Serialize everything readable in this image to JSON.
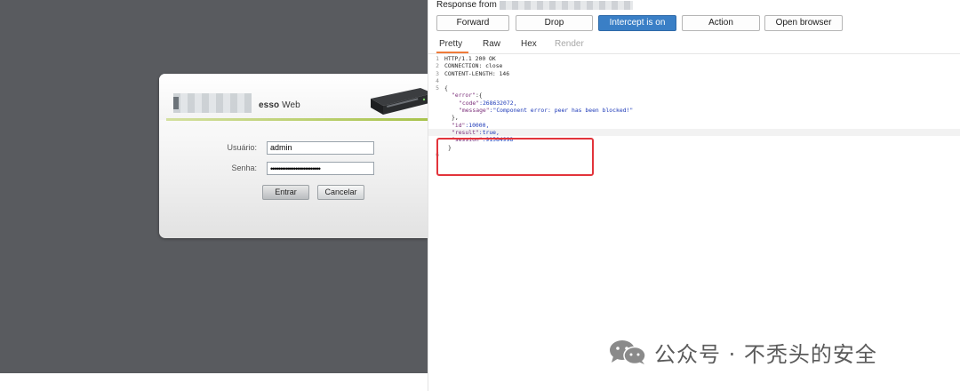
{
  "login": {
    "title_bold": "esso",
    "title_rest": " Web",
    "username_label": "Usuário:",
    "username_value": "admin",
    "password_label": "Senha:",
    "password_value": "••••••••••••••••••••••••••",
    "enter_button": "Entrar",
    "cancel_button": "Cancelar"
  },
  "burp": {
    "title": "Response from",
    "toolbar": {
      "forward": "Forward",
      "drop": "Drop",
      "intercept": "Intercept is on",
      "action": "Action",
      "open_browser": "Open browser"
    },
    "tabs": {
      "pretty": "Pretty",
      "raw": "Raw",
      "hex": "Hex",
      "render": "Render"
    },
    "lines": {
      "n1": "1",
      "t1": "HTTP/1.1 200 OK",
      "n2": "2",
      "t2": "CONNECTION: close",
      "n3": "3",
      "t3": "CONTENT-LENGTH: 146",
      "n4": "4",
      "n5": "5",
      "t5": "{",
      "t6_key": "\"error\"",
      "t6_rest": ":{",
      "t7_key": "\"code\"",
      "t7_val": ":268632072,",
      "t8_key": "\"message\"",
      "t8_val": ":\"Component error: peer has been blocked!\"",
      "t9": "},",
      "t10_key": "\"id\"",
      "t10_val": ":10000,",
      "t11_key": "\"result\"",
      "t11_val": ":true,",
      "t12_key": "\"session\"",
      "t12_val": ":91584998",
      "t13": "}",
      "n14": "6"
    }
  },
  "watermark": {
    "text": "公众号 · 不秃头的安全"
  },
  "colors": {
    "backdrop": "#595b5f",
    "intercept_active": "#3a7fc6",
    "tab_underline": "#ef7b3a",
    "highlight_box": "#e2343b",
    "json_key": "#7b2f7a",
    "json_value": "#1e3ab8"
  }
}
